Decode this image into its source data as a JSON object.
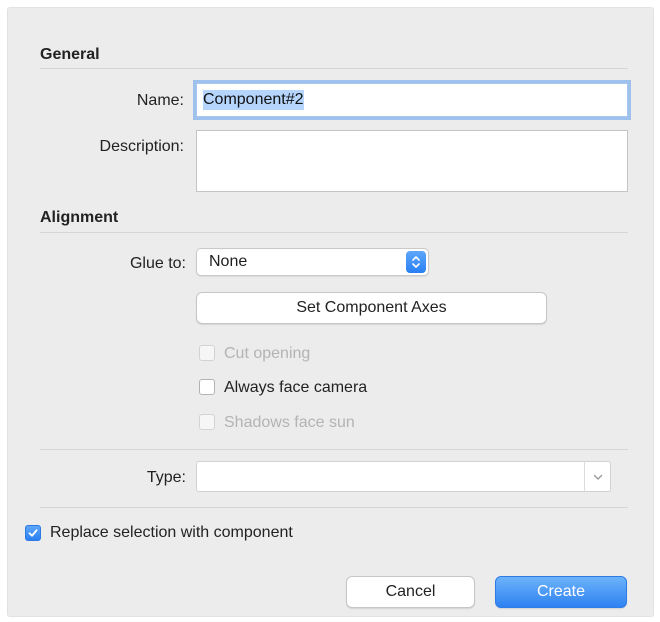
{
  "general": {
    "section_title": "General",
    "name_label": "Name:",
    "name_value": "Component#2",
    "description_label": "Description:",
    "description_value": ""
  },
  "alignment": {
    "section_title": "Alignment",
    "glue_label": "Glue to:",
    "glue_value": "None",
    "set_axes_label": "Set Component Axes",
    "cut_opening": {
      "label": "Cut opening",
      "checked": false,
      "enabled": false
    },
    "always_face_camera": {
      "label": "Always face camera",
      "checked": false,
      "enabled": true
    },
    "shadows_face_sun": {
      "label": "Shadows face sun",
      "checked": false,
      "enabled": false
    }
  },
  "type": {
    "label": "Type:",
    "value": ""
  },
  "replace_selection": {
    "label": "Replace selection with component",
    "checked": true
  },
  "buttons": {
    "cancel_label": "Cancel",
    "create_label": "Create"
  },
  "colors": {
    "accent": "#2f82f2",
    "focus_ring": "#9fc1ee",
    "text_selection": "#b5d5fd",
    "disabled_text": "#b3b3b3"
  },
  "icons": {
    "glue_popup": "updown-arrows-icon",
    "type_combo": "chevron-down-icon",
    "replace_check": "checkmark-icon"
  }
}
